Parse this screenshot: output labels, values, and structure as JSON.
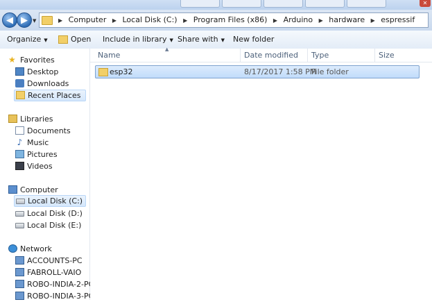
{
  "address": {
    "crumbs": [
      "Computer",
      "Local Disk (C:)",
      "Program Files (x86)",
      "Arduino",
      "hardware",
      "espressif"
    ]
  },
  "toolbar": {
    "organize": "Organize",
    "open": "Open",
    "include_in_library": "Include in library",
    "share_with": "Share with",
    "new_folder": "New folder"
  },
  "nav": {
    "favorites": "Favorites",
    "desktop": "Desktop",
    "downloads": "Downloads",
    "recent_places": "Recent Places",
    "libraries": "Libraries",
    "documents": "Documents",
    "music": "Music",
    "pictures": "Pictures",
    "videos": "Videos",
    "computer": "Computer",
    "disk_c": "Local Disk (C:)",
    "disk_d": "Local Disk (D:)",
    "disk_e": "Local Disk (E:)",
    "network": "Network",
    "net_1": "ACCOUNTS-PC",
    "net_2": "FABROLL-VAIO",
    "net_3": "ROBO-INDIA-2-PC",
    "net_4": "ROBO-INDIA-3-PC"
  },
  "columns": {
    "name": "Name",
    "date_modified": "Date modified",
    "type": "Type",
    "size": "Size"
  },
  "files": [
    {
      "name": "esp32",
      "date_modified": "8/17/2017 1:58 PM",
      "type": "File folder",
      "size": ""
    }
  ],
  "colors": {
    "selection": "#c1dcfb",
    "folder": "#f2cf68"
  }
}
